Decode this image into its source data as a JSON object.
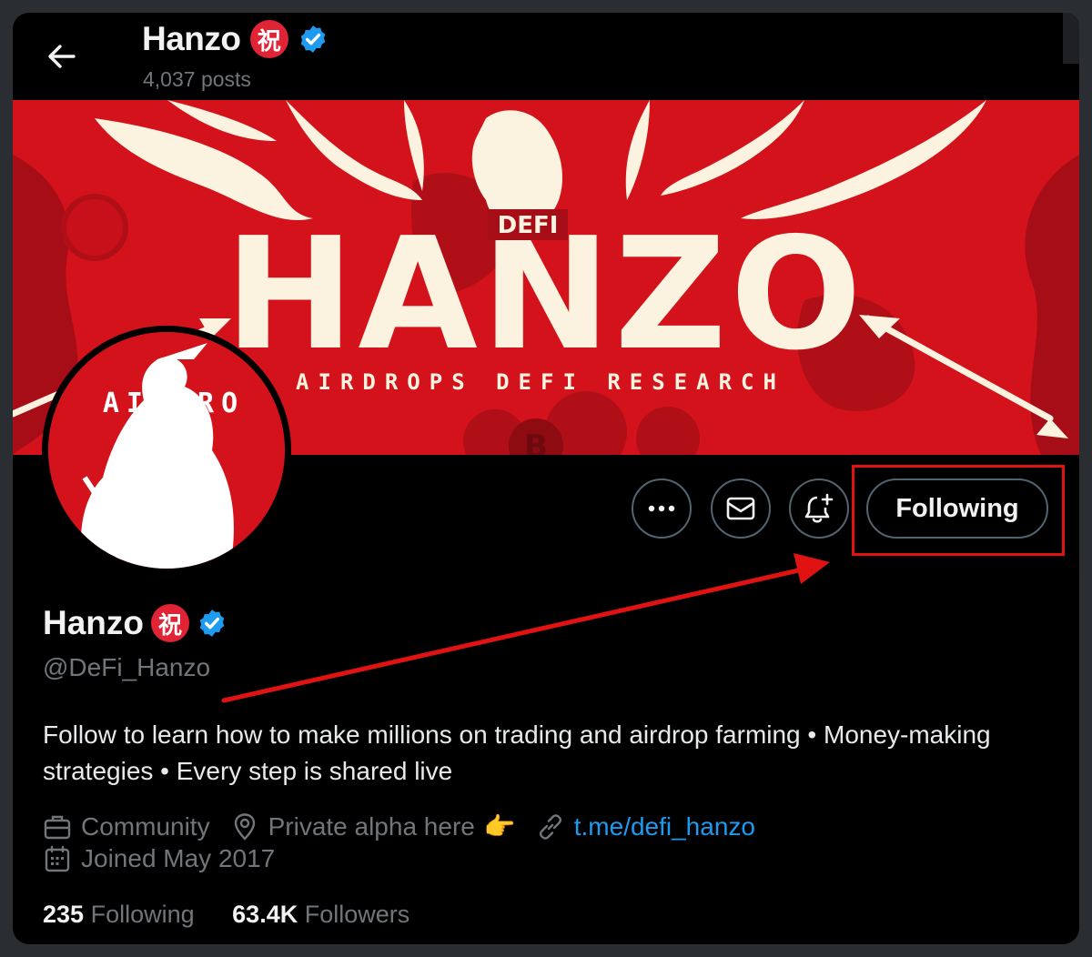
{
  "header": {
    "name": "Hanzo",
    "badge_char": "祝",
    "posts": "4,037 posts"
  },
  "banner": {
    "main_text": "HANZO",
    "tag_text": "DEFI",
    "subtitle": "AIRDROPS   DEFI   RESEARCH"
  },
  "avatar": {
    "text": "AIRDRO"
  },
  "actions": {
    "more_icon": "more-icon",
    "message_icon": "envelope-icon",
    "notify_icon": "bell-plus-icon",
    "follow_label": "Following"
  },
  "profile": {
    "name": "Hanzo",
    "badge_char": "祝",
    "handle": "@DeFi_Hanzo",
    "bio": "Follow to learn how to make millions on trading and airdrop farming • Money-making strategies • Every step is shared live",
    "category": "Community",
    "location": "Private alpha here",
    "location_emoji": "👉",
    "link": "t.me/defi_hanzo",
    "joined": "Joined May 2017"
  },
  "stats": {
    "following_count": "235",
    "following_label": "Following",
    "followers_count": "63.4K",
    "followers_label": "Followers"
  },
  "colors": {
    "accent_blue": "#1d9bf0",
    "annotation_red": "#e01212",
    "banner_red": "#d3121b",
    "banner_cream": "#fbf3df"
  }
}
